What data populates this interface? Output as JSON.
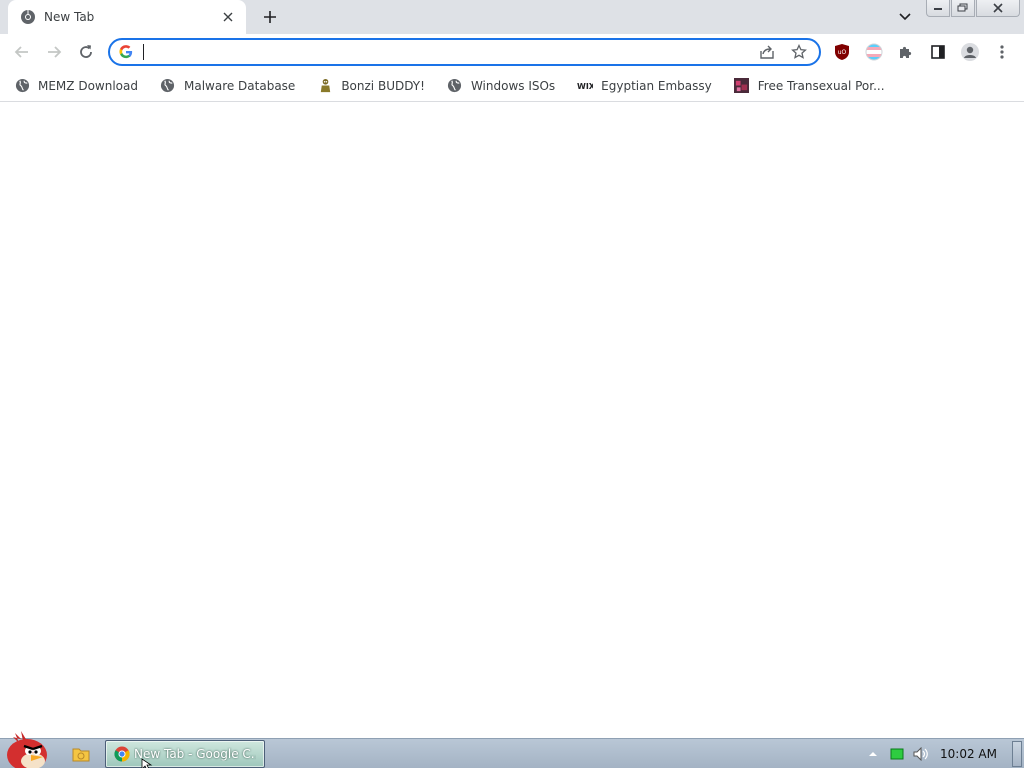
{
  "tabstrip": {
    "active_tab": {
      "title": "New Tab",
      "favicon": "chrome-icon",
      "close": "close-icon"
    },
    "new_tab": "plus-icon",
    "tab_search": "chevron-down-icon"
  },
  "window_controls": [
    "minimize-icon",
    "restore-icon",
    "close-icon"
  ],
  "toolbar": {
    "back": "arrow-left-icon",
    "forward": "arrow-right-icon",
    "reload": "reload-icon",
    "omnibox": {
      "value": "",
      "placeholder": "",
      "search_engine_icon": "google-g-icon",
      "share": "share-icon",
      "bookmark_star": "star-icon"
    },
    "extensions": [
      "ublock-icon",
      "pride-flag-extension-icon",
      "puzzle-icon",
      "side-panel-icon",
      "profile-icon",
      "kebab-menu-icon"
    ]
  },
  "bookmarks": [
    {
      "label": "MEMZ Download",
      "icon": "globe-icon"
    },
    {
      "label": "Malware Database",
      "icon": "globe-icon"
    },
    {
      "label": "Bonzi BUDDY!",
      "icon": "bonzi-icon"
    },
    {
      "label": "Windows ISOs",
      "icon": "globe-icon"
    },
    {
      "label": "Egyptian Embassy",
      "icon": "wix-icon"
    },
    {
      "label": "Free Transexual Por...",
      "icon": "site-icon"
    }
  ],
  "taskbar": {
    "start_icon": "angry-bird-start-icon",
    "quick_launch": "folder-icon",
    "window_button": {
      "label": "New Tab - Google C...",
      "icon": "chrome-icon"
    },
    "tray": [
      "tray-up-arrow-icon",
      "network-icon",
      "volume-icon"
    ],
    "clock": "10:02 AM"
  },
  "colors": {
    "accent": "#1a73e8",
    "tabstrip_bg": "#dee1e6",
    "taskbar_bg": "#a4b3c4"
  }
}
